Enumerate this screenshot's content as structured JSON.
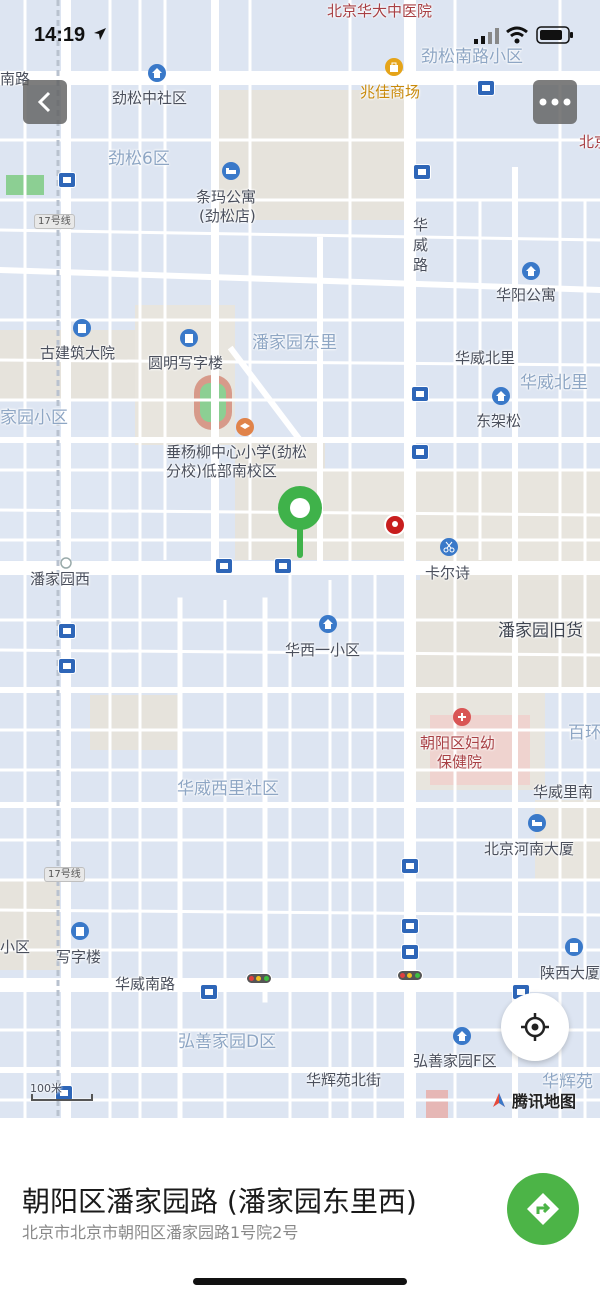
{
  "status_bar": {
    "time": "14:19"
  },
  "map": {
    "labels": [
      {
        "text": "北京华大中医院",
        "cls": "red"
      },
      {
        "text": "南路",
        "cls": ""
      },
      {
        "text": "劲松中社区",
        "cls": ""
      },
      {
        "text": "兆佳商场",
        "cls": "gold"
      },
      {
        "text": "劲松南路小区",
        "cls": "dist"
      },
      {
        "text": "北京",
        "cls": "red"
      },
      {
        "text": "劲松6区",
        "cls": "dist"
      },
      {
        "text": "条玛公寓",
        "cls": ""
      },
      {
        "text": "(劲松店)",
        "cls": ""
      },
      {
        "text": "华",
        "cls": ""
      },
      {
        "text": "威",
        "cls": ""
      },
      {
        "text": "路",
        "cls": ""
      },
      {
        "text": "华阳公寓",
        "cls": ""
      },
      {
        "text": "古建筑大院",
        "cls": ""
      },
      {
        "text": "圆明写字楼",
        "cls": ""
      },
      {
        "text": "潘家园东里",
        "cls": "dist"
      },
      {
        "text": "华威北里",
        "cls": ""
      },
      {
        "text": "华威北里",
        "cls": "dist"
      },
      {
        "text": "家园小区",
        "cls": "dist"
      },
      {
        "text": "东架松",
        "cls": ""
      },
      {
        "text": "垂杨柳中心小学(劲松",
        "cls": ""
      },
      {
        "text": "分校)低部南校区",
        "cls": ""
      },
      {
        "text": "潘家园西",
        "cls": ""
      },
      {
        "text": "卡尔诗",
        "cls": ""
      },
      {
        "text": "潘家园旧货",
        "cls": "big"
      },
      {
        "text": "华西一小区",
        "cls": ""
      },
      {
        "text": "朝阳区妇幼",
        "cls": "red"
      },
      {
        "text": "保健院",
        "cls": "red"
      },
      {
        "text": "百环",
        "cls": "dist"
      },
      {
        "text": "华威西里社区",
        "cls": "dist"
      },
      {
        "text": "华威里南",
        "cls": ""
      },
      {
        "text": "北京河南大厦",
        "cls": ""
      },
      {
        "text": "小区",
        "cls": ""
      },
      {
        "text": "写字楼",
        "cls": ""
      },
      {
        "text": "陕西大厦",
        "cls": ""
      },
      {
        "text": "华威南路",
        "cls": ""
      },
      {
        "text": "弘善家园D区",
        "cls": "dist"
      },
      {
        "text": "弘善家园F区",
        "cls": ""
      },
      {
        "text": "华辉苑北街",
        "cls": ""
      },
      {
        "text": "华辉苑",
        "cls": "dist"
      }
    ],
    "line_badges": [
      "17号线",
      "17号线"
    ],
    "scale_label": "100米",
    "brand": "腾讯地图"
  },
  "buttons": {
    "back_icon": "chevron-left-icon",
    "more_icon": "more-dots-icon",
    "locate_icon": "crosshair-icon",
    "navigate_icon": "navigation-arrow-icon"
  },
  "place": {
    "title": "朝阳区潘家园路 (潘家园东里西)",
    "address": "北京市北京市朝阳区潘家园路1号院2号"
  },
  "colors": {
    "accent": "#4cb447",
    "map_bg": "#dde5f2",
    "bus_stop": "#2e66b8"
  }
}
